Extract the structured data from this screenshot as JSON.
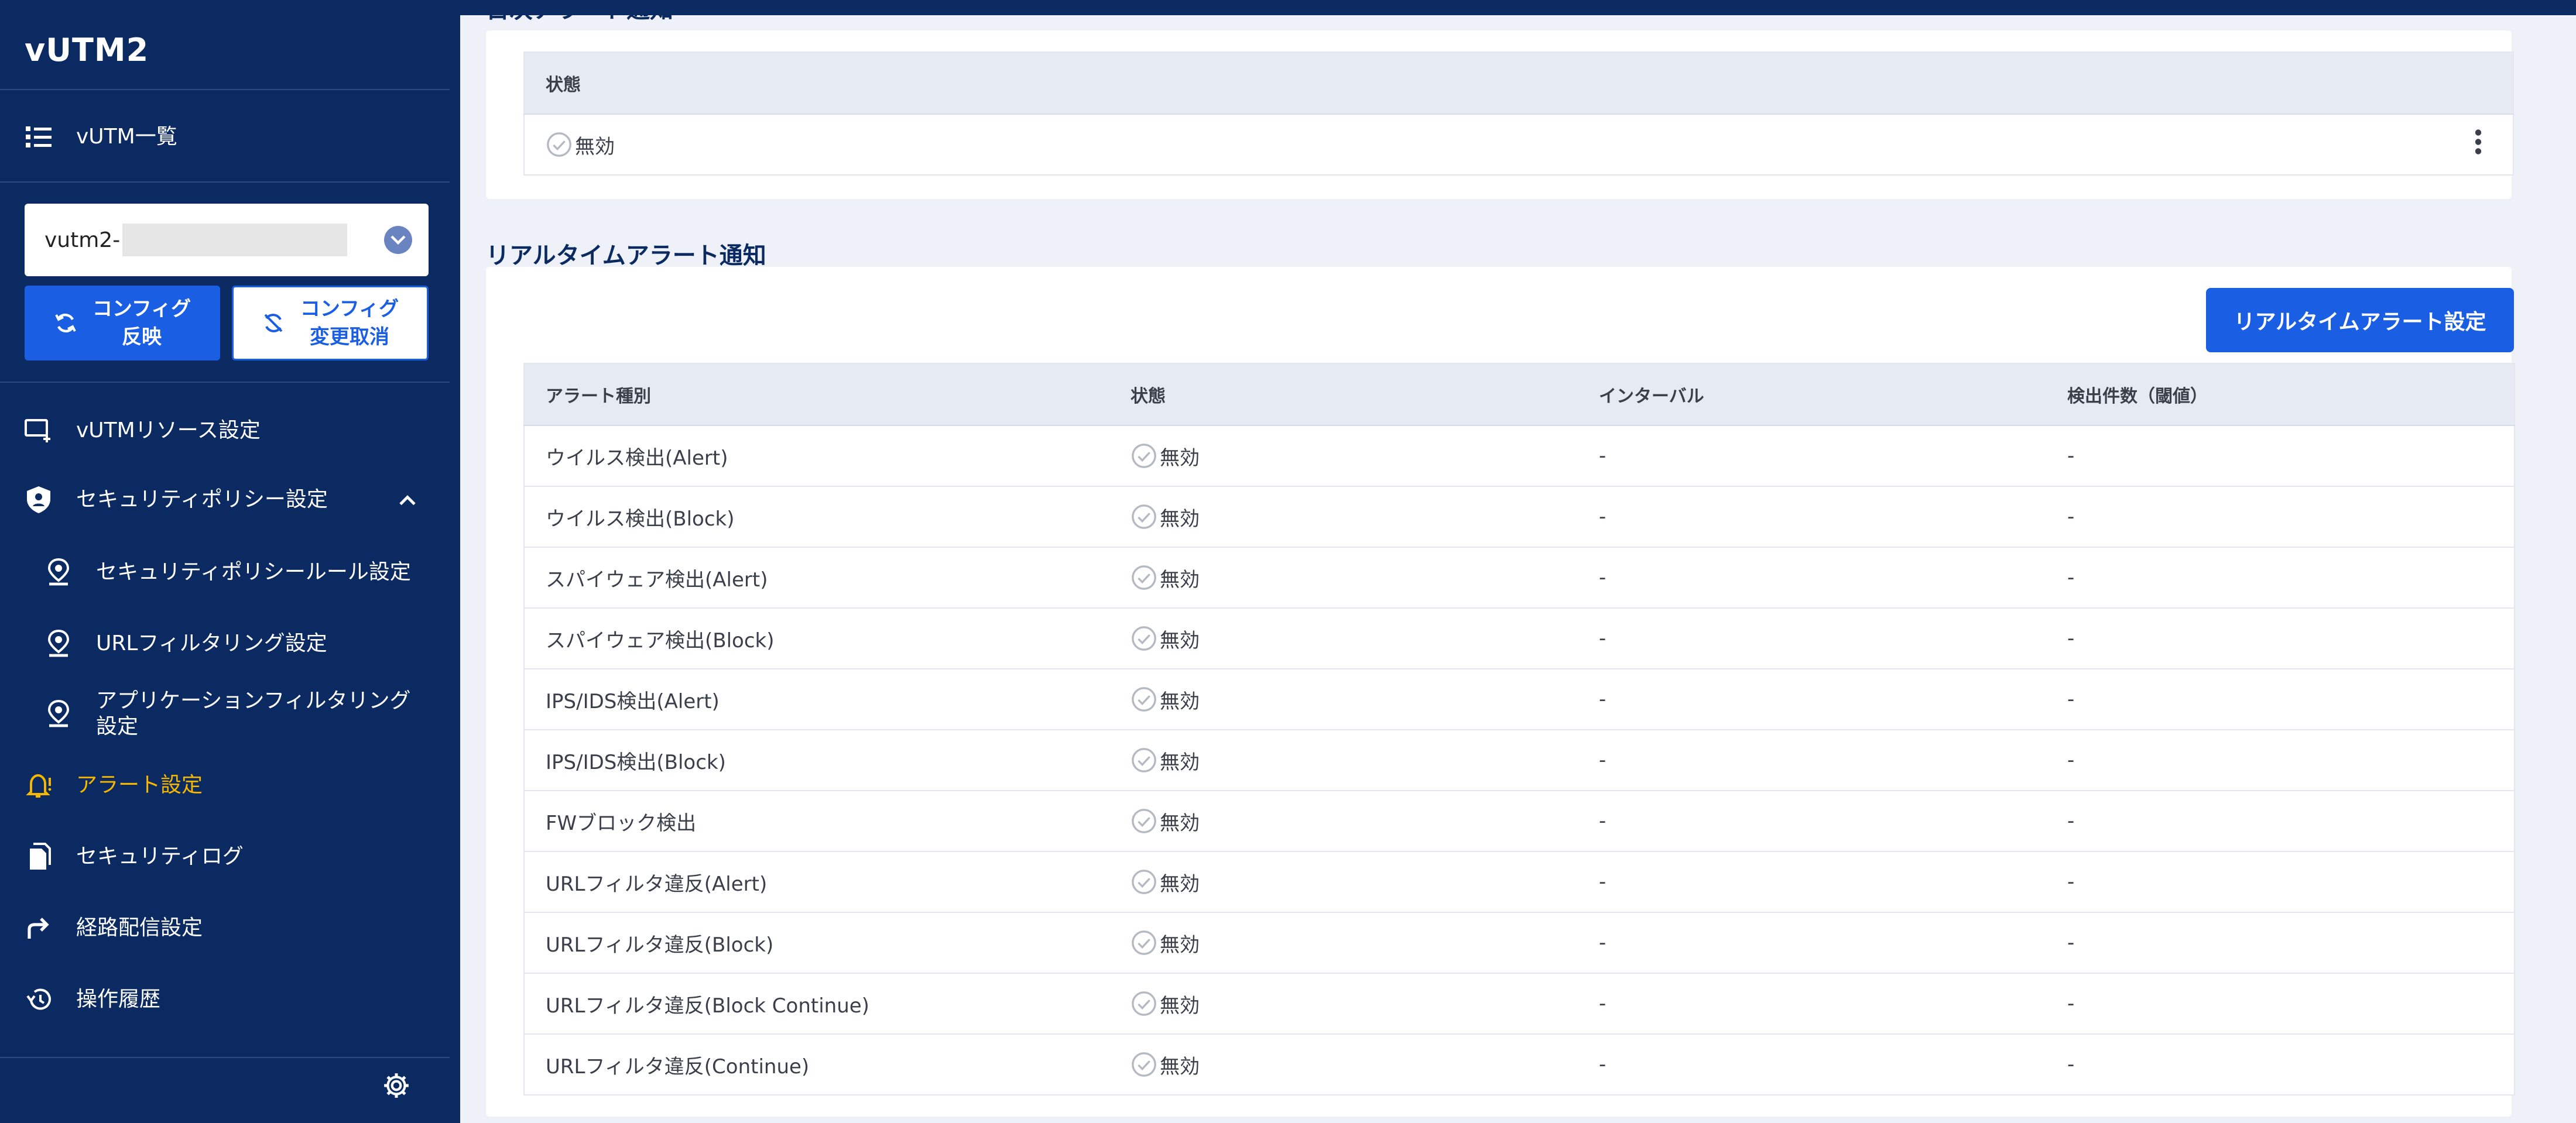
{
  "app": {
    "title": "vUTM2"
  },
  "sidebar": {
    "list_label": "vUTM一覧",
    "select_value": "vutm2-",
    "apply_button": {
      "line1": "コンフィグ",
      "line2": "反映"
    },
    "cancel_button": {
      "line1": "コンフィグ",
      "line2": "変更取消"
    },
    "items": [
      {
        "label": "vUTMリソース設定",
        "icon": "monitor-add-icon"
      },
      {
        "label": "セキュリティポリシー設定",
        "icon": "shield-icon"
      },
      {
        "label": "セキュリティポリシールール設定",
        "icon": "pin-icon"
      },
      {
        "label": "URLフィルタリング設定",
        "icon": "pin-icon"
      },
      {
        "label_line1": "アプリケーションフィルタリング",
        "label_line2": "設定",
        "icon": "pin-icon"
      },
      {
        "label": "アラート設定",
        "icon": "bell-icon"
      },
      {
        "label": "セキュリティログ",
        "icon": "document-icon"
      },
      {
        "label": "経路配信設定",
        "icon": "route-arrow-icon"
      },
      {
        "label": "操作履歴",
        "icon": "history-icon"
      }
    ]
  },
  "daily_alert": {
    "title_partial": "日次アラート通知",
    "header": "状態",
    "status": "無効"
  },
  "realtime_alert": {
    "title": "リアルタイムアラート通知",
    "settings_button": "リアルタイムアラート設定",
    "columns": [
      "アラート種別",
      "状態",
      "インターバル",
      "検出件数（閾値）"
    ],
    "rows": [
      {
        "type": "ウイルス検出(Alert)",
        "status": "無効",
        "interval": "-",
        "threshold": "-"
      },
      {
        "type": "ウイルス検出(Block)",
        "status": "無効",
        "interval": "-",
        "threshold": "-"
      },
      {
        "type": "スパイウェア検出(Alert)",
        "status": "無効",
        "interval": "-",
        "threshold": "-"
      },
      {
        "type": "スパイウェア検出(Block)",
        "status": "無効",
        "interval": "-",
        "threshold": "-"
      },
      {
        "type": "IPS/IDS検出(Alert)",
        "status": "無効",
        "interval": "-",
        "threshold": "-"
      },
      {
        "type": "IPS/IDS検出(Block)",
        "status": "無効",
        "interval": "-",
        "threshold": "-"
      },
      {
        "type": "FWブロック検出",
        "status": "無効",
        "interval": "-",
        "threshold": "-"
      },
      {
        "type": "URLフィルタ違反(Alert)",
        "status": "無効",
        "interval": "-",
        "threshold": "-"
      },
      {
        "type": "URLフィルタ違反(Block)",
        "status": "無効",
        "interval": "-",
        "threshold": "-"
      },
      {
        "type": "URLフィルタ違反(Block Continue)",
        "status": "無効",
        "interval": "-",
        "threshold": "-"
      },
      {
        "type": "URLフィルタ違反(Continue)",
        "status": "無効",
        "interval": "-",
        "threshold": "-"
      }
    ]
  },
  "colors": {
    "sidebar_bg": "#0b2a62",
    "accent": "#1a5fe3",
    "active": "#f5b700"
  }
}
